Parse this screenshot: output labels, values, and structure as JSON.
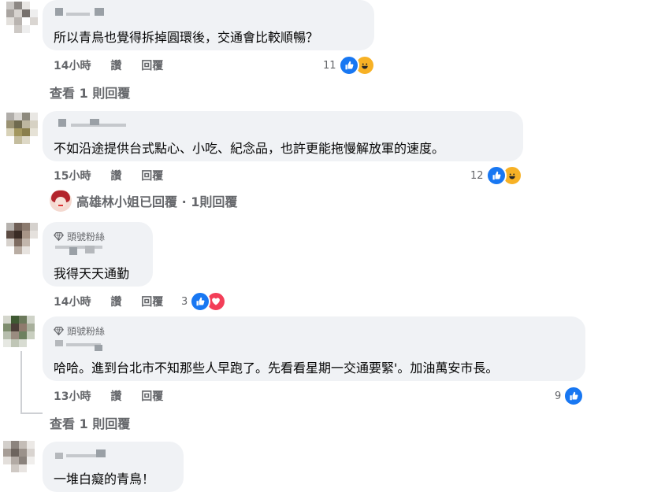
{
  "comments": [
    {
      "text": "所以青鳥也覺得拆掉圓環後，交通會比較順暢？",
      "time": "14小時",
      "like": "讚",
      "reply": "回覆",
      "reaction_count": "11"
    },
    {
      "text": "不如沿途提供台式點心、小吃、紀念品，也許更能拖慢解放軍的速度。",
      "time": "15小時",
      "like": "讚",
      "reply": "回覆",
      "reaction_count": "12"
    },
    {
      "badge": "頭號粉絲",
      "text": "我得天天通勤",
      "time": "14小時",
      "like": "讚",
      "reply": "回覆",
      "reaction_count": "3"
    },
    {
      "badge": "頭號粉絲",
      "text": "哈哈。進到台北市不知那些人早跑了。先看看星期一交通要緊'。加油萬安市長。",
      "time": "13小時",
      "like": "讚",
      "reply": "回覆",
      "reaction_count": "9"
    },
    {
      "text": "一堆白癡的青鳥！"
    }
  ],
  "view_replies_1": "查看 1 則回覆",
  "view_replies_2": "查看 1 則回覆",
  "replied_summary": "高雄林小姐已回覆 · 1則回覆",
  "colors": {
    "like": "#1877f2",
    "haha": "#f7b125",
    "love": "#f33e58",
    "bubble": "#f0f2f5",
    "meta": "#65676b"
  },
  "icons": [
    "like-icon",
    "haha-icon",
    "love-icon",
    "top-fan-diamond-icon"
  ]
}
